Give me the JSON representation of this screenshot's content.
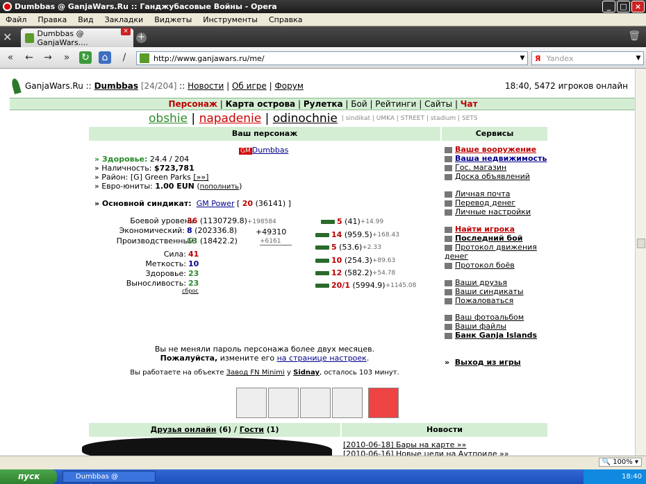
{
  "window": {
    "title": "Dumbbas @ GanjaWars.Ru :: Ганджубасовые Войны - Opera"
  },
  "menu": [
    "Файл",
    "Правка",
    "Вид",
    "Закладки",
    "Виджеты",
    "Инструменты",
    "Справка"
  ],
  "tab": {
    "label": "Dumbbas @ GanjaWars...."
  },
  "address": {
    "url": "http://www.ganjawars.ru/me/",
    "search_placeholder": "Yandex",
    "search_engine": "Я"
  },
  "header": {
    "site": "GanjaWars.Ru",
    "sep": "::",
    "user": "Dumbbas",
    "level": "[24/204]",
    "links": [
      "Новости",
      "Об игре",
      "Форум"
    ],
    "status": "18:40, 5472 игроков онлайн"
  },
  "mainmenu": [
    "Персонаж",
    "Карта острова",
    "Рулетка",
    "Бой",
    "Рейтинги",
    "Сайты",
    "Чат"
  ],
  "bigtabs": {
    "a": "obshie",
    "b": "napadenie",
    "c": "odinochnie",
    "rest": "| sindikat | UMKA | STREET | stadium | SETS"
  },
  "character": {
    "head": "Ваш персонаж",
    "badge": "GM",
    "name": "Dumbbas",
    "health_label": "» Здоровье:",
    "health": "24.4 / 204",
    "cash_label": "» Наличность:",
    "cash": "$723,781",
    "district_label": "» Район:",
    "district": "[G] Green Parks",
    "district_link": "[»»]",
    "euro_label": "» Евро-юниты:",
    "euro": "1.00 EUN",
    "euro_link": "пополнить",
    "synd_label": "» Основной синдикат:",
    "synd_name": "GM Power",
    "synd_num": "20",
    "synd_pts": "(36141)",
    "levels": [
      {
        "label": "Боевой уровень:",
        "lvl": "36",
        "val": "(1130729.8)",
        "inc": "+198584"
      },
      {
        "label": "Экономический:",
        "lvl": "8",
        "val": "(202336.8)",
        "inc": "+49310"
      },
      {
        "label": "Производственный:",
        "lvl": "13",
        "val": "(18422.2)",
        "inc": "+6161"
      }
    ],
    "stats": [
      {
        "label": "Сила:",
        "val": "41"
      },
      {
        "label": "Меткость:",
        "val": "10"
      },
      {
        "label": "Здоровье:",
        "val": "23"
      },
      {
        "label": "Выносливость:",
        "val": "23"
      }
    ],
    "reset": "сброс",
    "weapons": [
      {
        "lvl": "5",
        "val": "(41)",
        "inc": "+14.99"
      },
      {
        "lvl": "14",
        "val": "(959.5)",
        "inc": "+168.43"
      },
      {
        "lvl": "5",
        "val": "(53.6)",
        "inc": "+2.33"
      },
      {
        "lvl": "10",
        "val": "(254.3)",
        "inc": "+89.63"
      },
      {
        "lvl": "12",
        "val": "(582.2)",
        "inc": "+54.78"
      },
      {
        "lvl": "20/1",
        "val": "(5994.9)",
        "inc": "+1145.08"
      }
    ],
    "msg1": "Вы не меняли пароль персонажа более двух месяцев.",
    "msg2_bold": "Пожалуйста,",
    "msg2": "измените его",
    "msg2_link": "на странице настроек",
    "msg3": "Вы работаете на объекте",
    "msg3_obj": "Завод FN Minimi",
    "msg3_at": "у",
    "msg3_owner": "Sidnay",
    "msg3_end": ", осталось 103 минут."
  },
  "services": {
    "head": "Сервисы",
    "groups": [
      [
        "Ваше вооружение",
        "Ваша недвижимость",
        "Гос. магазин",
        "Доска объявлений"
      ],
      [
        "Личная почта",
        "Перевод денег",
        "Личные настройки"
      ],
      [
        "Найти игрока",
        "Последний бой",
        "Протокол движения денег",
        "Протокол боёв"
      ],
      [
        "Ваши друзья",
        "Ваши синдикаты",
        "Пожаловаться"
      ],
      [
        "Ваш фотоальбом",
        "Ваши файлы",
        "Банк Ganja Islands"
      ]
    ],
    "exit": "Выход из игры"
  },
  "bottom": {
    "friends": "Друзья онлайн",
    "friends_n": "(6)",
    "slash": "/",
    "guests": "Гости",
    "guests_n": "(1)",
    "news_head": "Новости",
    "news1": "[2010-06-18] Бары на карте »»",
    "news2": "[2010-06-16] Новые цели на Аутпоиде »»"
  },
  "status": {
    "zoom": "100%"
  },
  "taskbar": {
    "start": "пуск",
    "task": "Dumbbas @ GanjaWa...",
    "clock": "18:40"
  }
}
